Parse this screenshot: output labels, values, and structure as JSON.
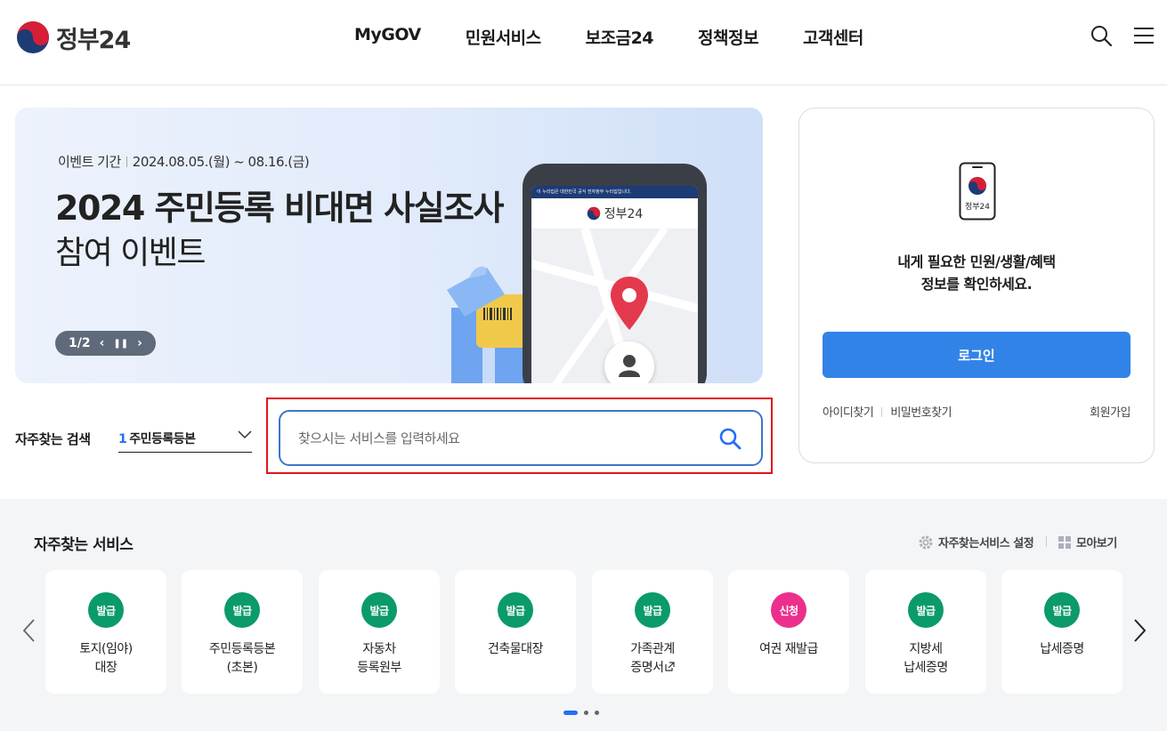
{
  "header": {
    "logo_text": "정부24",
    "nav": [
      "MyGOV",
      "민원서비스",
      "보조금24",
      "정책정보",
      "고객센터"
    ],
    "icons": [
      "search-icon",
      "menu-icon"
    ]
  },
  "banner": {
    "period_label": "이벤트 기간",
    "period_value": "2024.08.05.(월) ~ 08.16.(금)",
    "title": "2024 주민등록 비대면 사실조사",
    "subtitle": "참여 이벤트",
    "slide_counter": "1/2",
    "phone_logo": "정부24",
    "phone_notice": "이 누리집은 대한민국 공식 전자정부 누리집입니다."
  },
  "login": {
    "card_icon_label": "정부24",
    "message_line1": "내게 필요한 민원/생활/혜택",
    "message_line2": "정보를 확인하세요.",
    "login_button": "로그인",
    "find_id": "아이디찾기",
    "find_password": "비밀번호찾기",
    "join": "회원가입"
  },
  "search": {
    "frequent_label": "자주찾는 검색",
    "selected_rank": "1",
    "selected_term": "주민등록등본",
    "placeholder": "찾으시는 서비스를 입력하세요"
  },
  "services": {
    "title": "자주찾는 서비스",
    "settings_label": "자주찾는서비스 설정",
    "view_all_label": "모아보기",
    "items": [
      {
        "badge": "발급",
        "line1": "토지(임야)",
        "line2": "대장"
      },
      {
        "badge": "발급",
        "line1": "주민등록등본",
        "line2": "(초본)"
      },
      {
        "badge": "발급",
        "line1": "자동차",
        "line2": "등록원부"
      },
      {
        "badge": "발급",
        "line1": "건축물대장",
        "line2": ""
      },
      {
        "badge": "발급",
        "line1": "가족관계",
        "line2": "증명서"
      },
      {
        "badge": "신청",
        "line1": "여권 재발급",
        "line2": ""
      },
      {
        "badge": "발급",
        "line1": "지방세",
        "line2": "납세증명"
      },
      {
        "badge": "발급",
        "line1": "납세증명",
        "line2": ""
      }
    ],
    "pagination_pages": 3,
    "active_page": 1
  },
  "colors": {
    "accent_blue": "#3183e8",
    "badge_green": "#0b9a6a",
    "badge_pink": "#ec2f8c",
    "highlight_red": "#e2141c"
  }
}
